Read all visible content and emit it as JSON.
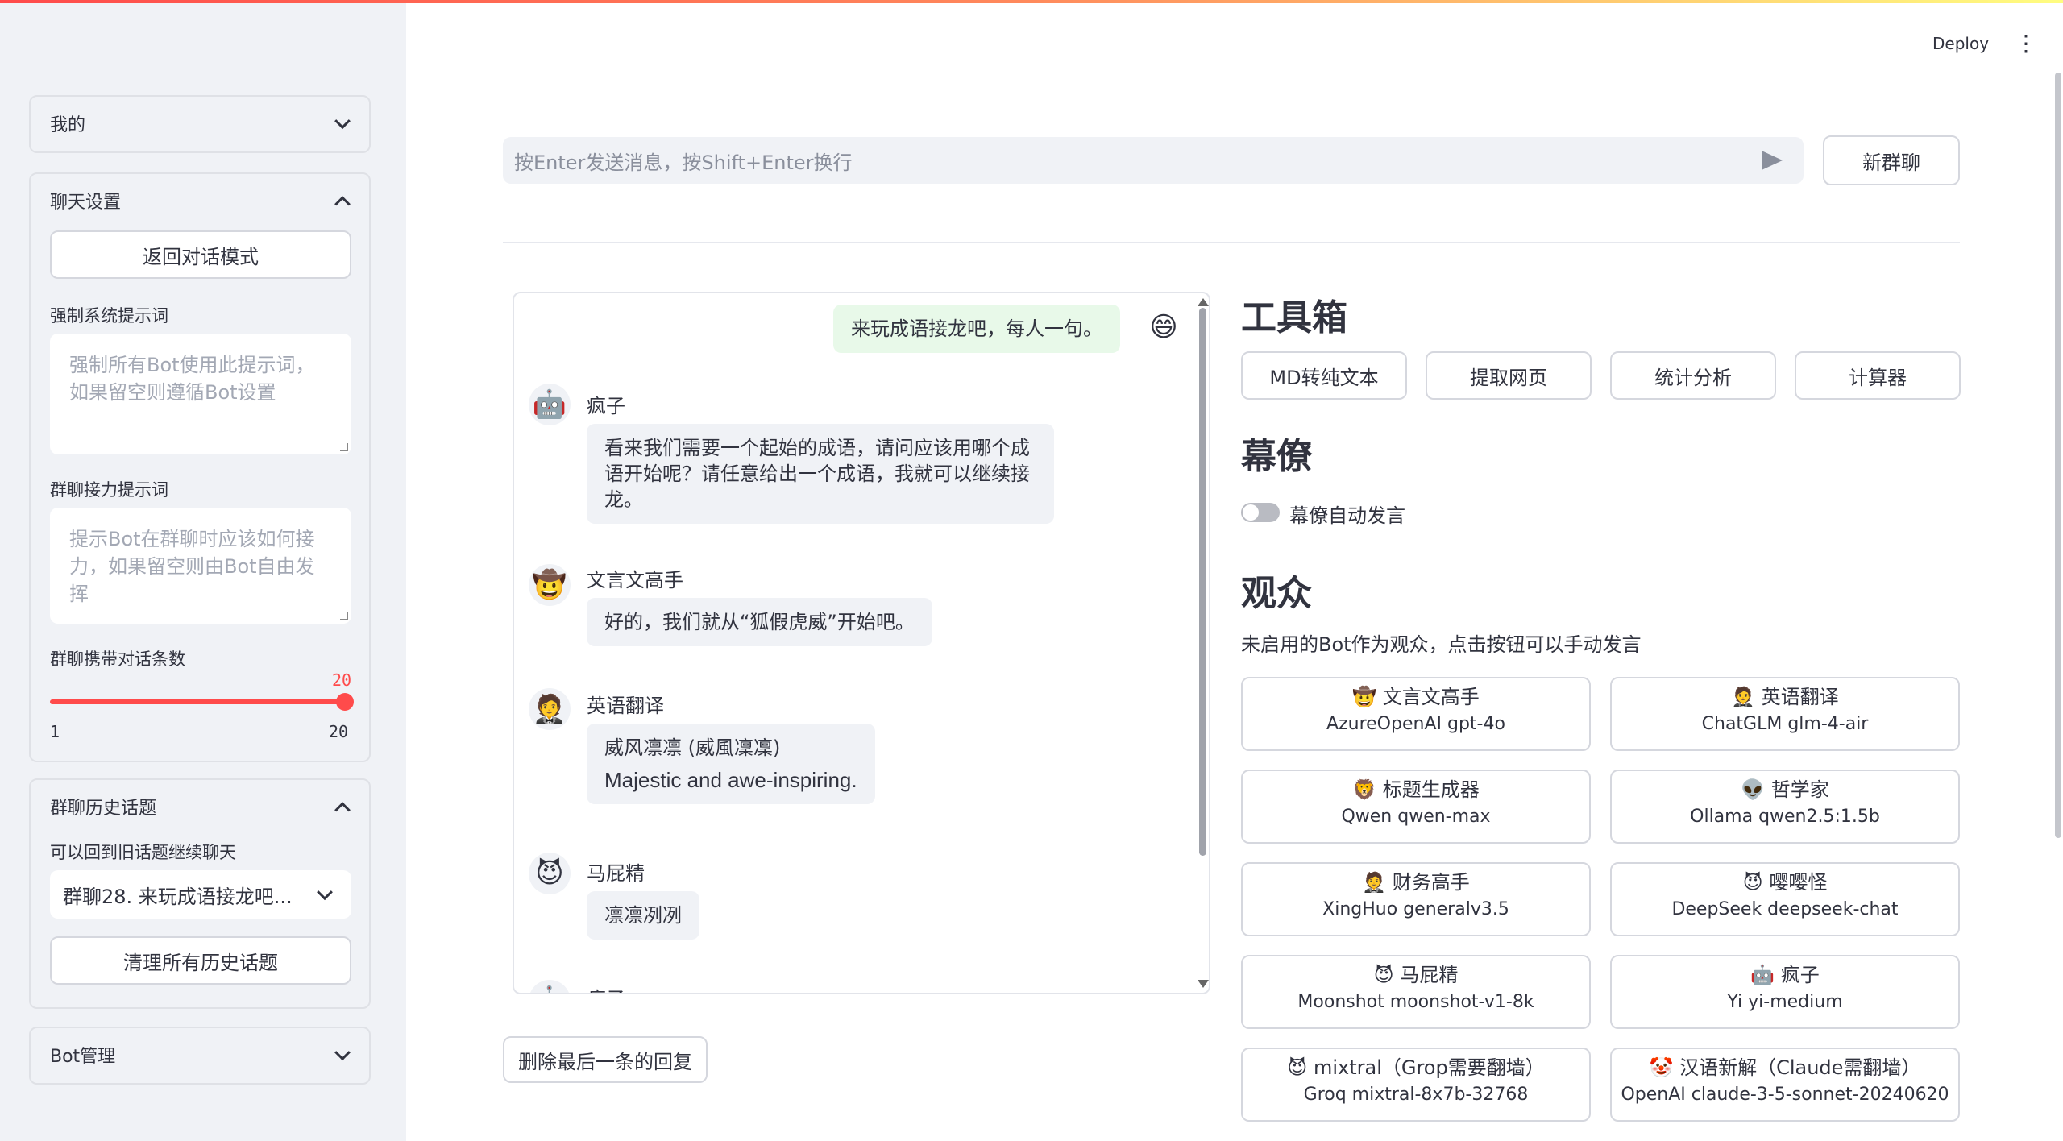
{
  "header": {
    "deploy_label": "Deploy",
    "menu_icon": "⋮"
  },
  "sidebar": {
    "mine": {
      "label": "我的"
    },
    "chat_settings": {
      "label": "聊天设置",
      "back_button": "返回对话模式",
      "sys_prompt_label": "强制系统提示词",
      "sys_prompt_placeholder": "强制所有Bot使用此提示词，如果留空则遵循Bot设置",
      "relay_label": "群聊接力提示词",
      "relay_placeholder": "提示Bot在群聊时应该如何接力，如果留空则由Bot自由发挥",
      "history_count_label": "群聊携带对话条数",
      "slider_value": "20",
      "slider_min": "1",
      "slider_max": "20",
      "slider_fraction": 1.0
    },
    "history": {
      "label": "群聊历史话题",
      "hint": "可以回到旧话题继续聊天",
      "selected": "群聊28. 来玩成语接龙吧...",
      "clear_button": "清理所有历史话题"
    },
    "bot_manage": {
      "label": "Bot管理"
    }
  },
  "main": {
    "chat_input_placeholder": "按Enter发送消息，按Shift+Enter换行",
    "new_group_button": "新群聊",
    "delete_last_button": "删除最后一条的回复",
    "messages": [
      {
        "role": "user",
        "avatar": "😄",
        "text": "来玩成语接龙吧，每人一句。"
      },
      {
        "name": "疯子",
        "avatar": "🤖",
        "text": "看来我们需要一个起始的成语，请问应该用哪个成语开始呢？请任意给出一个成语，我就可以继续接龙。"
      },
      {
        "name": "文言文高手",
        "avatar": "🤠",
        "text": "好的，我们就从“狐假虎威”开始吧。"
      },
      {
        "name": "英语翻译",
        "avatar": "🤵",
        "line1": "威风凛凛 (威風凜凜)",
        "line2": "Majestic and awe-inspiring."
      },
      {
        "name": "马屁精",
        "avatar": "😈",
        "text": "凛凛冽冽"
      },
      {
        "name": "疯子",
        "avatar": "🤖"
      }
    ],
    "toolbox": {
      "title": "工具箱",
      "buttons": [
        "MD转纯文本",
        "提取网页",
        "统计分析",
        "计算器"
      ]
    },
    "staff": {
      "title": "幕僚",
      "toggle_label": "幕僚自动发言"
    },
    "audience": {
      "title": "观众",
      "hint": "未启用的Bot作为观众，点击按钮可以手动发言",
      "bots": [
        {
          "icon": "🤠",
          "name": "文言文高手",
          "model": "AzureOpenAI gpt-4o"
        },
        {
          "icon": "🤵",
          "name": "英语翻译",
          "model": "ChatGLM glm-4-air"
        },
        {
          "icon": "🦁",
          "name": "标题生成器",
          "model": "Qwen qwen-max"
        },
        {
          "icon": "👽",
          "name": "哲学家",
          "model": "Ollama qwen2.5:1.5b"
        },
        {
          "icon": "🤵",
          "name": "财务高手",
          "model": "XingHuo generalv3.5"
        },
        {
          "icon": "😈",
          "name": "嘤嘤怪",
          "model": "DeepSeek deepseek-chat"
        },
        {
          "icon": "😈",
          "name": "马屁精",
          "model": "Moonshot moonshot-v1-8k"
        },
        {
          "icon": "🤖",
          "name": "疯子",
          "model": "Yi yi-medium"
        },
        {
          "icon": "😈",
          "name": "mixtral（Grop需要翻墙）",
          "model": "Groq mixtral-8x7b-32768"
        },
        {
          "icon": "🤡",
          "name": "汉语新解（Claude需翻墙）",
          "model": "OpenAI claude-3-5-sonnet-20240620"
        }
      ]
    }
  }
}
